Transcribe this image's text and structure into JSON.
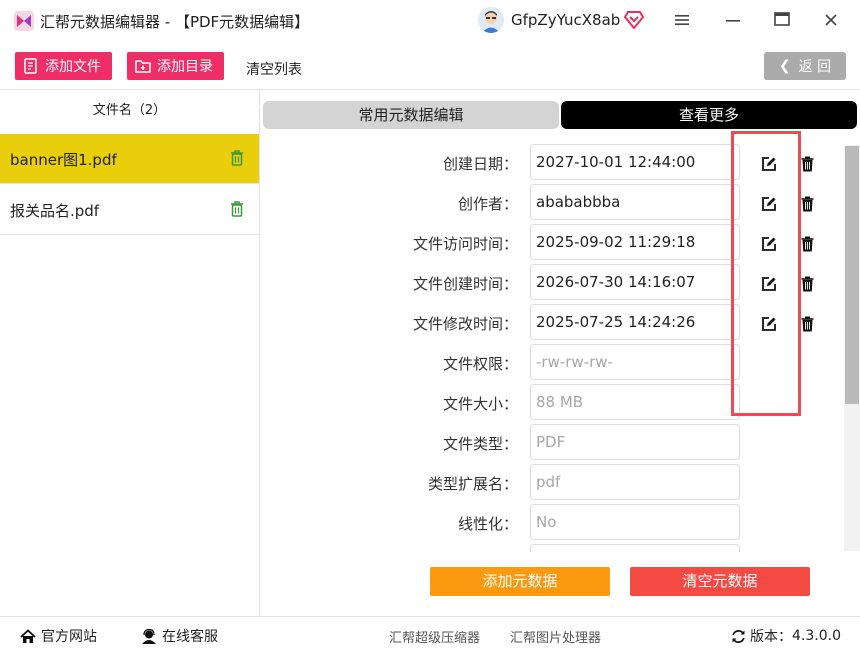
{
  "window": {
    "title": "汇帮元数据编辑器 - 【PDF元数据编辑】",
    "user_name": "GfpZyYucX8ab"
  },
  "toolbar": {
    "add_file": "添加文件",
    "add_folder": "添加目录",
    "clear_list": "清空列表",
    "back": "返 回"
  },
  "sidebar": {
    "header": "文件名（2）",
    "files": [
      {
        "name": "banner图1.pdf",
        "selected": true
      },
      {
        "name": "报关品名.pdf",
        "selected": false
      }
    ]
  },
  "tabs": {
    "common": "常用元数据编辑",
    "more": "查看更多"
  },
  "fields": [
    {
      "label": "创建日期：",
      "value": "2027-10-01 12:44:00",
      "editable": true
    },
    {
      "label": "创作者：",
      "value": "abababbba",
      "editable": true
    },
    {
      "label": "文件访问时间：",
      "value": "2025-09-02 11:29:18",
      "editable": true
    },
    {
      "label": "文件创建时间：",
      "value": "2026-07-30 14:16:07",
      "editable": true
    },
    {
      "label": "文件修改时间：",
      "value": "2025-07-25 14:24:26",
      "editable": true
    },
    {
      "label": "文件权限：",
      "value": "-rw-rw-rw-",
      "editable": false
    },
    {
      "label": "文件大小：",
      "value": "88 MB",
      "editable": false
    },
    {
      "label": "文件类型：",
      "value": "PDF",
      "editable": false
    },
    {
      "label": "类型扩展名：",
      "value": "pdf",
      "editable": false
    },
    {
      "label": "线性化：",
      "value": "No",
      "editable": false
    }
  ],
  "actions": {
    "add_meta": "添加元数据",
    "clear_meta": "清空元数据"
  },
  "statusbar": {
    "website": "官方网站",
    "support": "在线客服",
    "compressor": "汇帮超级压缩器",
    "image_tool": "汇帮图片处理器",
    "version_label": "版本：",
    "version": "4.3.0.0"
  },
  "colors": {
    "accent_pink": "#ef2e67",
    "selected_yellow": "#e8ce0b",
    "add_orange": "#fb9a10",
    "clear_red": "#f34a44",
    "highlight_red": "#ef4a52"
  }
}
